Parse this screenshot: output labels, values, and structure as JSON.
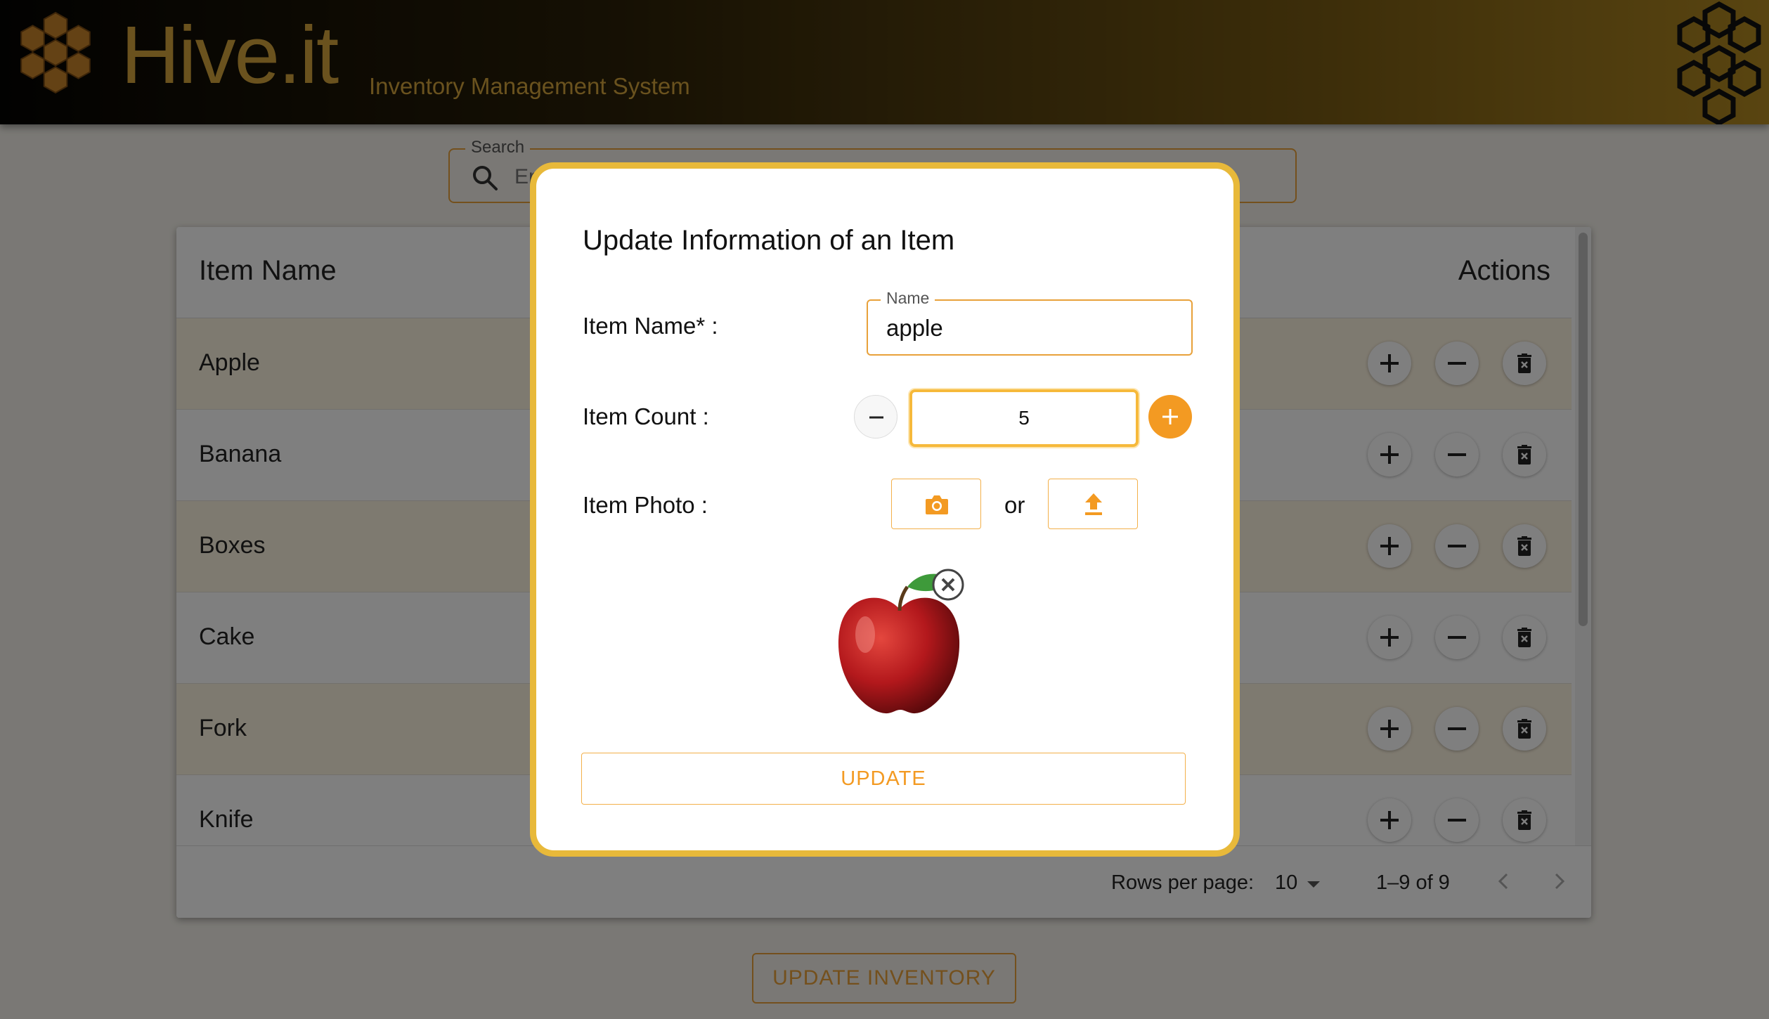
{
  "header": {
    "brand": "Hive.it",
    "subtitle": "Inventory Management System",
    "logo_icon": "honeycomb-logo-icon",
    "decoration_icon": "honeycomb-outline-icon"
  },
  "search": {
    "label": "Search",
    "placeholder": "Enter item name",
    "icon": "search-icon"
  },
  "table": {
    "columns": [
      "Item Name",
      "Actions"
    ],
    "rows": [
      {
        "name": "Apple"
      },
      {
        "name": "Banana"
      },
      {
        "name": "Boxes"
      },
      {
        "name": "Cake"
      },
      {
        "name": "Fork"
      },
      {
        "name": "Knife"
      }
    ],
    "row_action_icons": [
      "add-icon",
      "remove-icon",
      "delete-icon"
    ]
  },
  "pagination": {
    "rows_per_page_label": "Rows per page:",
    "rows_per_page": "10",
    "range": "1–9 of 9"
  },
  "footer": {
    "update_inventory_label": "UPDATE INVENTORY"
  },
  "modal": {
    "title": "Update Information of an Item",
    "item_name_label": "Item Name* :",
    "name_field_label": "Name",
    "name_value": "apple",
    "item_count_label": "Item Count :",
    "count_value": "5",
    "item_photo_label": "Item Photo :",
    "or_text": "or",
    "update_label": "UPDATE",
    "photo_icons": [
      "camera-icon",
      "upload-icon"
    ]
  },
  "colors": {
    "accent": "#f39a22",
    "gold": "#d4a53d",
    "modal_border": "#e8b93a",
    "row_highlight": "#fdf4e0"
  }
}
